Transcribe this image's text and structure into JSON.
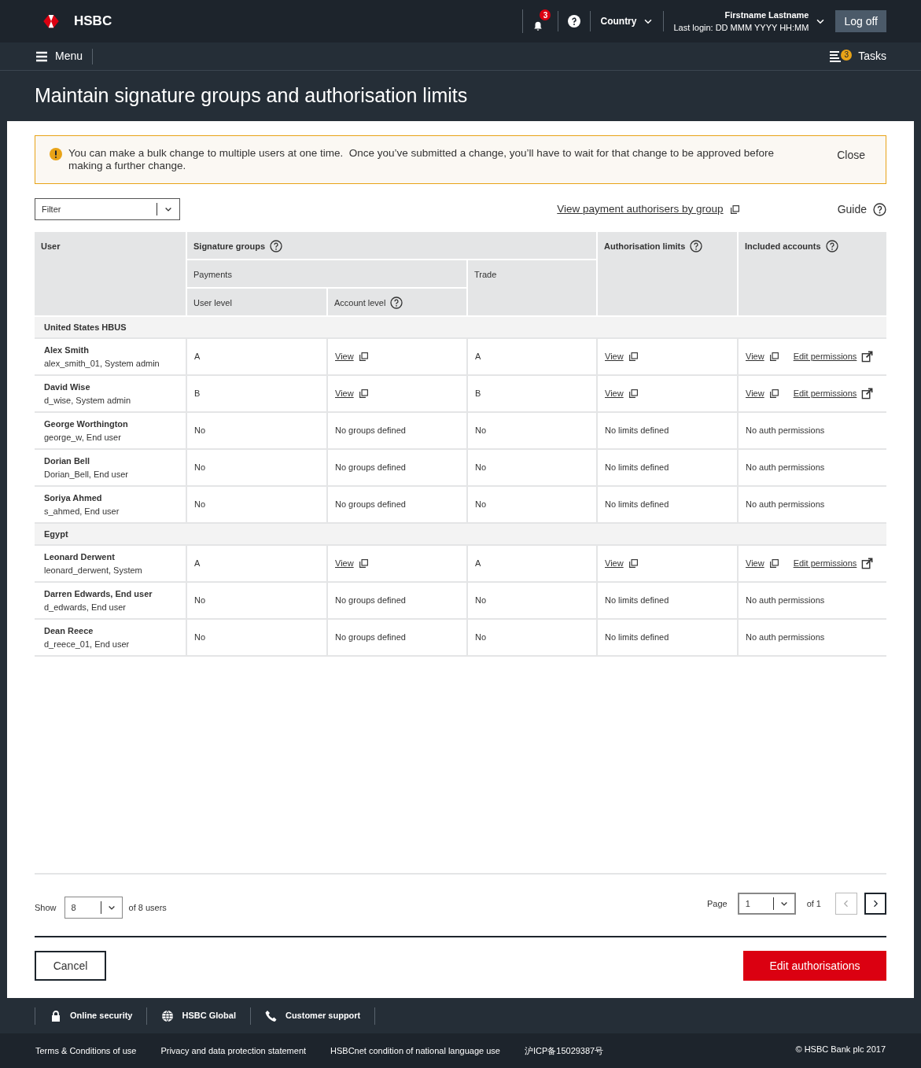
{
  "header": {
    "logo": "HSBC",
    "notifications": "3",
    "country": "Country",
    "user_name": "Firstname Lastname",
    "last_login": "Last login: DD MMM YYYY HH:MM",
    "logoff": "Log off"
  },
  "nav": {
    "menu": "Menu",
    "tasks_count": "3",
    "tasks": "Tasks"
  },
  "page_title": "Maintain signature groups and authorisation limits",
  "alert": {
    "text": "You can make a bulk change to multiple users at one time.  Once you’ve submitted a change, you’ll have to wait for that change to be approved before making a further change.",
    "close": "Close"
  },
  "toolbar": {
    "filter_placeholder": "Filter",
    "view_link": "View payment authorisers by group",
    "guide": "Guide"
  },
  "table": {
    "headers": {
      "user": "User",
      "signature_groups": "Signature groups",
      "payments": "Payments",
      "trade": "Trade",
      "user_level": "User level",
      "account_level": "Account level",
      "limits": "Authorisation limits",
      "accounts": "Included accounts"
    },
    "rows": [
      {
        "kind": "group",
        "label": "United States HBUS"
      },
      {
        "kind": "user",
        "name": "Alex Smith",
        "detail": "alex_smith_01, System admin",
        "user_level": "A",
        "account_level": {
          "kind": "link",
          "text": "View"
        },
        "trade": "A",
        "limits": {
          "kind": "link",
          "text": "View"
        },
        "accounts": [
          {
            "kind": "link",
            "text": "View"
          },
          {
            "kind": "edit",
            "text": "Edit permissions"
          }
        ]
      },
      {
        "kind": "user",
        "name": "David Wise",
        "detail": "d_wise, System admin",
        "user_level": "B",
        "account_level": {
          "kind": "link",
          "text": "View"
        },
        "trade": "B",
        "limits": {
          "kind": "link",
          "text": "View"
        },
        "accounts": [
          {
            "kind": "link",
            "text": "View"
          },
          {
            "kind": "edit",
            "text": "Edit permissions"
          }
        ]
      },
      {
        "kind": "user",
        "name": "George Worthington",
        "detail": "george_w, End user",
        "user_level": "No",
        "account_level": {
          "kind": "text",
          "text": "No groups defined"
        },
        "trade": "No",
        "limits": {
          "kind": "text",
          "text": "No limits defined"
        },
        "accounts": [
          {
            "kind": "text",
            "text": "No auth permissions"
          }
        ]
      },
      {
        "kind": "user",
        "name": "Dorian Bell",
        "detail": "Dorian_Bell, End user",
        "user_level": "No",
        "account_level": {
          "kind": "text",
          "text": "No groups defined"
        },
        "trade": "No",
        "limits": {
          "kind": "text",
          "text": "No limits defined"
        },
        "accounts": [
          {
            "kind": "text",
            "text": "No auth permissions"
          }
        ]
      },
      {
        "kind": "user",
        "name": "Soriya Ahmed",
        "detail": "s_ahmed, End user",
        "user_level": "No",
        "account_level": {
          "kind": "text",
          "text": "No groups defined"
        },
        "trade": "No",
        "limits": {
          "kind": "text",
          "text": "No limits defined"
        },
        "accounts": [
          {
            "kind": "text",
            "text": "No auth permissions"
          }
        ]
      },
      {
        "kind": "group",
        "label": "Egypt"
      },
      {
        "kind": "user",
        "name": "Leonard Derwent",
        "detail": "leonard_derwent, System",
        "user_level": "A",
        "account_level": {
          "kind": "link",
          "text": "View"
        },
        "trade": "A",
        "limits": {
          "kind": "link",
          "text": "View"
        },
        "accounts": [
          {
            "kind": "link",
            "text": "View"
          },
          {
            "kind": "edit",
            "text": "Edit permissions"
          }
        ]
      },
      {
        "kind": "user",
        "name": "Darren Edwards, End user",
        "detail": "d_edwards, End user",
        "user_level": "No",
        "account_level": {
          "kind": "text",
          "text": "No groups defined"
        },
        "trade": "No",
        "limits": {
          "kind": "text",
          "text": "No limits defined"
        },
        "accounts": [
          {
            "kind": "text",
            "text": "No auth permissions"
          }
        ]
      },
      {
        "kind": "user",
        "name": "Dean Reece",
        "detail": "d_reece_01, End user",
        "user_level": "No",
        "account_level": {
          "kind": "text",
          "text": "No groups defined"
        },
        "trade": "No",
        "limits": {
          "kind": "text",
          "text": "No limits defined"
        },
        "accounts": [
          {
            "kind": "text",
            "text": "No auth permissions"
          }
        ]
      }
    ]
  },
  "pagination": {
    "show_label": "Show",
    "page_size": "8",
    "of_users": "of 8 users",
    "page_label": "Page",
    "page": "1",
    "of_pages": "of 1",
    "prev_disabled": true,
    "next_disabled": false
  },
  "actions": {
    "cancel": "Cancel",
    "submit": "Edit authorisations"
  },
  "footer_links": [
    "Online security",
    "HSBC Global",
    "Customer support"
  ],
  "legal_links": [
    "Terms & Conditions of use",
    "Privacy and data protection statement",
    "HSBCnet condition of national language use",
    "沪ICP备15029387号"
  ],
  "copyright": "© HSBC Bank plc 2017"
}
